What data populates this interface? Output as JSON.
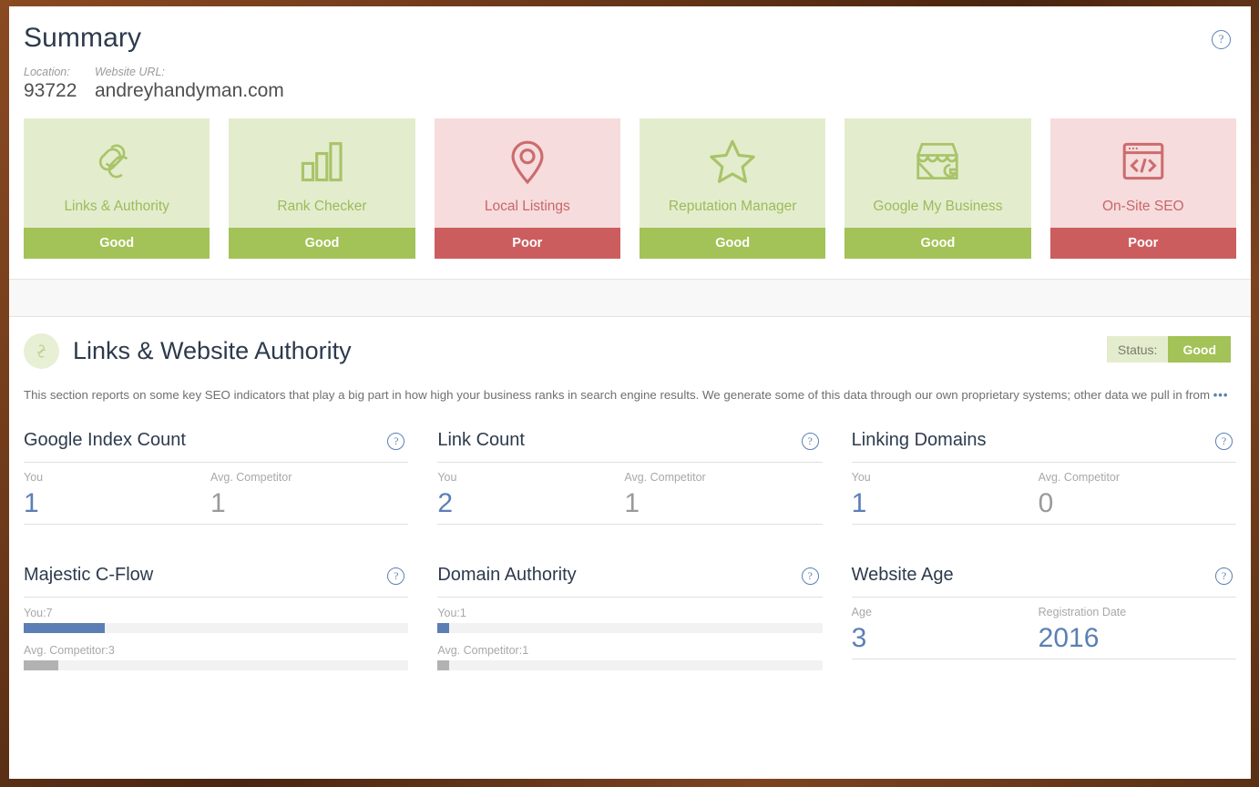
{
  "header": {
    "title": "Summary",
    "help_icon": "question-circle-icon",
    "location_label": "Location:",
    "location_value": "93722",
    "url_label": "Website URL:",
    "url_value": "andreyhandyman.com"
  },
  "summary_cards": [
    {
      "label": "Links & Authority",
      "status": "Good",
      "state": "good",
      "icon": "chain-link-icon"
    },
    {
      "label": "Rank Checker",
      "status": "Good",
      "state": "good",
      "icon": "bar-chart-icon"
    },
    {
      "label": "Local Listings",
      "status": "Poor",
      "state": "poor",
      "icon": "map-pin-icon"
    },
    {
      "label": "Reputation Manager",
      "status": "Good",
      "state": "good",
      "icon": "star-icon"
    },
    {
      "label": "Google My Business",
      "status": "Good",
      "state": "good",
      "icon": "storefront-icon"
    },
    {
      "label": "On-Site SEO",
      "status": "Poor",
      "state": "poor",
      "icon": "code-window-icon"
    }
  ],
  "detail_section": {
    "icon": "chain-link-icon",
    "title": "Links & Website Authority",
    "status_label": "Status:",
    "status_value": "Good",
    "description": "This section reports on some key SEO indicators that play a big part in how high your business ranks in search engine results. We generate some of this data through our own proprietary systems; other data we pull in from",
    "more_ellipsis": "•••"
  },
  "metrics": [
    {
      "title": "Google Index Count",
      "type": "kv",
      "help_icon": "question-circle-icon",
      "col1_label": "You",
      "col1_value": "1",
      "col1_style": "you",
      "col2_label": "Avg. Competitor",
      "col2_value": "1",
      "col2_style": "comp"
    },
    {
      "title": "Link Count",
      "type": "kv",
      "help_icon": "question-circle-icon",
      "col1_label": "You",
      "col1_value": "2",
      "col1_style": "you",
      "col2_label": "Avg. Competitor",
      "col2_value": "1",
      "col2_style": "comp"
    },
    {
      "title": "Linking Domains",
      "type": "kv",
      "help_icon": "question-circle-icon",
      "col1_label": "You",
      "col1_value": "1",
      "col1_style": "you",
      "col2_label": "Avg. Competitor",
      "col2_value": "0",
      "col2_style": "comp"
    },
    {
      "title": "Majestic C-Flow",
      "type": "bars",
      "help_icon": "question-circle-icon",
      "bar1_label": "You:7",
      "bar1_pct": 7,
      "bar2_label": "Avg. Competitor:3",
      "bar2_pct": 3
    },
    {
      "title": "Domain Authority",
      "type": "bars",
      "help_icon": "question-circle-icon",
      "bar1_label": "You:1",
      "bar1_pct": 1,
      "bar2_label": "Avg. Competitor:1",
      "bar2_pct": 1
    },
    {
      "title": "Website Age",
      "type": "kv",
      "help_icon": "question-circle-icon",
      "col1_label": "Age",
      "col1_value": "3",
      "col1_style": "blue",
      "col2_label": "Registration Date",
      "col2_value": "2016",
      "col2_style": "blue"
    }
  ],
  "chart_data": {
    "type": "bar",
    "title": "Links & Website Authority metrics",
    "categories": [
      "Google Index Count",
      "Link Count",
      "Linking Domains",
      "Majestic C-Flow",
      "Domain Authority",
      "Website Age"
    ],
    "series": [
      {
        "name": "You",
        "values": [
          1,
          2,
          1,
          7,
          1,
          3
        ]
      },
      {
        "name": "Avg. Competitor",
        "values": [
          1,
          1,
          0,
          3,
          1,
          null
        ]
      }
    ],
    "bar_scale_max": 100,
    "xlabel": "",
    "ylabel": "",
    "legend": [
      "You",
      "Avg. Competitor"
    ]
  },
  "colors": {
    "good_light": "#e3edcd",
    "good_dark": "#a3c257",
    "poor_light": "#f6dcdc",
    "poor_dark": "#cc5d5f",
    "accent_blue": "#5b7fb5",
    "text_dark": "#2d3a4d",
    "muted": "#a8a8a8"
  }
}
